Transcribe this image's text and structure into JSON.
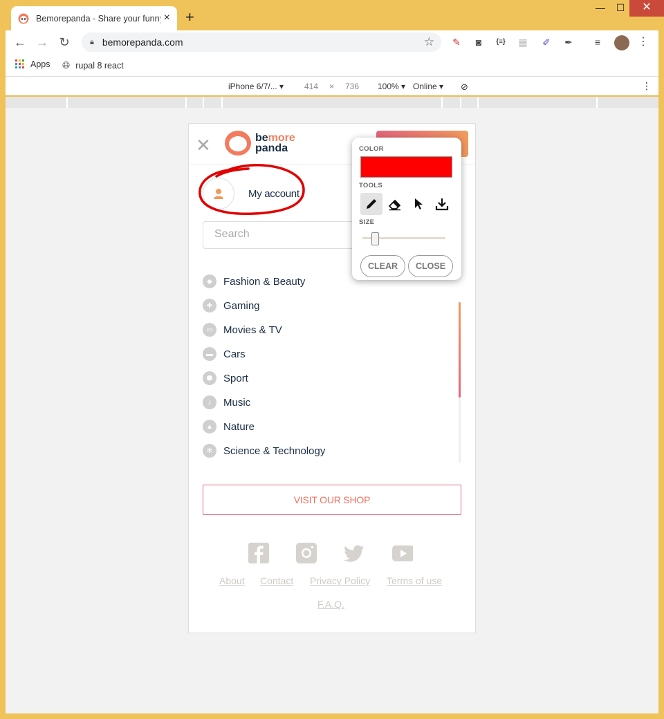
{
  "browser": {
    "tab_title": "Bemorepanda - Share your funny",
    "url": "bemorepanda.com",
    "bookmarks": [
      {
        "label": "Apps",
        "icon": "apps-grid-icon"
      },
      {
        "label": "rupal 8 react",
        "icon": "globe-icon"
      }
    ],
    "window_controls": {
      "minimize": "—",
      "maximize": "☐",
      "close": "✕"
    }
  },
  "device_toolbar": {
    "device": "iPhone 6/7/...",
    "width": "414",
    "times": "×",
    "height": "736",
    "zoom": "100%",
    "network": "Online"
  },
  "page": {
    "logo": {
      "be": "be",
      "more": "more",
      "panda": "panda"
    },
    "account_label": "My account",
    "search_placeholder": "Search",
    "categories": [
      {
        "label": "Fashion & Beauty",
        "icon": "diamond-icon"
      },
      {
        "label": "Gaming",
        "icon": "gamepad-icon"
      },
      {
        "label": "Movies & TV",
        "icon": "tv-icon"
      },
      {
        "label": "Cars",
        "icon": "car-icon"
      },
      {
        "label": "Sport",
        "icon": "soccer-ball-icon"
      },
      {
        "label": "Music",
        "icon": "music-note-icon"
      },
      {
        "label": "Nature",
        "icon": "mountain-icon"
      },
      {
        "label": "Science & Technology",
        "icon": "atom-icon"
      }
    ],
    "shop_button": "VISIT OUR SHOP",
    "social": [
      "facebook-icon",
      "instagram-icon",
      "twitter-icon",
      "youtube-icon"
    ],
    "footer_links": [
      "About",
      "Contact",
      "Privacy Policy",
      "Terms of use",
      "F.A.Q."
    ]
  },
  "draw_widget": {
    "color_label": "COLOR",
    "color_value": "#ff0000",
    "tools_label": "TOOLS",
    "tools": [
      "pencil-icon",
      "eraser-icon",
      "pointer-icon",
      "download-icon"
    ],
    "size_label": "SIZE",
    "size_level": 0.15,
    "clear_label": "CLEAR",
    "close_label": "CLOSE"
  }
}
